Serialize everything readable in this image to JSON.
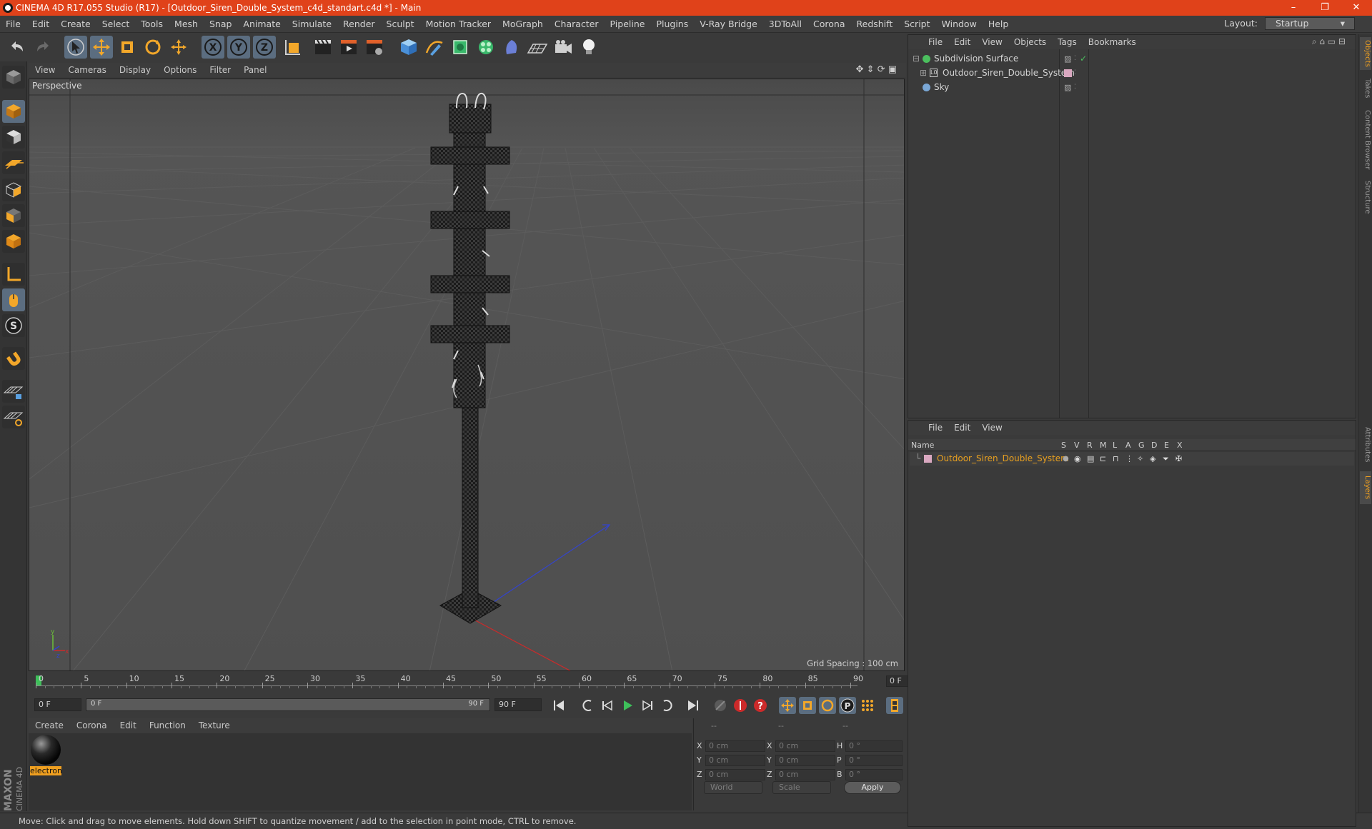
{
  "window": {
    "title": "CINEMA 4D R17.055 Studio (R17) - [Outdoor_Siren_Double_System_c4d_standart.c4d *] - Main",
    "minimize": "–",
    "maximize": "❐",
    "close": "✕"
  },
  "menubar": {
    "items": [
      "File",
      "Edit",
      "Create",
      "Select",
      "Tools",
      "Mesh",
      "Snap",
      "Animate",
      "Simulate",
      "Render",
      "Sculpt",
      "Motion Tracker",
      "MoGraph",
      "Character",
      "Pipeline",
      "Plugins",
      "V-Ray Bridge",
      "3DToAll",
      "Corona",
      "Redshift",
      "Script",
      "Window",
      "Help"
    ],
    "layout_label": "Layout:",
    "layout_value": "Startup"
  },
  "viewport": {
    "menu": [
      "View",
      "Cameras",
      "Display",
      "Options",
      "Filter",
      "Panel"
    ],
    "name": "Perspective",
    "grid_spacing": "Grid Spacing : 100 cm"
  },
  "timeline": {
    "ticks": [
      "0",
      "5",
      "10",
      "15",
      "20",
      "25",
      "30",
      "35",
      "40",
      "45",
      "50",
      "55",
      "60",
      "65",
      "70",
      "75",
      "80",
      "85",
      "90"
    ],
    "current_frame": "0 F"
  },
  "transport": {
    "start_field": "0 F",
    "range_start": "0 F",
    "range_end": "90 F",
    "end_field": "90 F"
  },
  "material_manager": {
    "menu": [
      "Create",
      "Corona",
      "Edit",
      "Function",
      "Texture"
    ],
    "materials": [
      {
        "name": "electron"
      }
    ]
  },
  "coordinates": {
    "header": [
      "--",
      "--",
      "--"
    ],
    "rows": [
      {
        "a": "X",
        "av": "0 cm",
        "b": "X",
        "bv": "0 cm",
        "c": "H",
        "cv": "0 °"
      },
      {
        "a": "Y",
        "av": "0 cm",
        "b": "Y",
        "bv": "0 cm",
        "c": "P",
        "cv": "0 °"
      },
      {
        "a": "Z",
        "av": "0 cm",
        "b": "Z",
        "bv": "0 cm",
        "c": "B",
        "cv": "0 °"
      }
    ],
    "space": "World",
    "mode": "Scale",
    "apply": "Apply"
  },
  "object_manager": {
    "menu": [
      "File",
      "Edit",
      "View",
      "Objects",
      "Tags",
      "Bookmarks"
    ],
    "objects": [
      {
        "name": "Subdivision Surface",
        "color": "#4bbf5e"
      },
      {
        "name": "Outdoor_Siren_Double_System",
        "color": "#d9a8c0"
      },
      {
        "name": "Sky",
        "color": "#7aa7d6"
      }
    ]
  },
  "layer_manager": {
    "menu": [
      "File",
      "Edit",
      "View"
    ],
    "columns": [
      "Name",
      "S",
      "V",
      "R",
      "M",
      "L",
      "A",
      "G",
      "D",
      "E",
      "X"
    ],
    "layers": [
      {
        "name": "Outdoor_Siren_Double_System",
        "color": "#e8a020"
      }
    ]
  },
  "right_tabs": [
    "Objects",
    "Takes",
    "Content Browser",
    "Structure",
    "Attributes",
    "Layers"
  ],
  "status": "Move: Click and drag to move elements. Hold down SHIFT to quantize movement / add to the selection in point mode, CTRL to remove.",
  "branding": {
    "line1": "MAXON",
    "line2": "CINEMA 4D"
  },
  "colors": {
    "title_bar": "#e0421a",
    "accent": "#f0a020",
    "selected_tool": "#5b6d80"
  }
}
